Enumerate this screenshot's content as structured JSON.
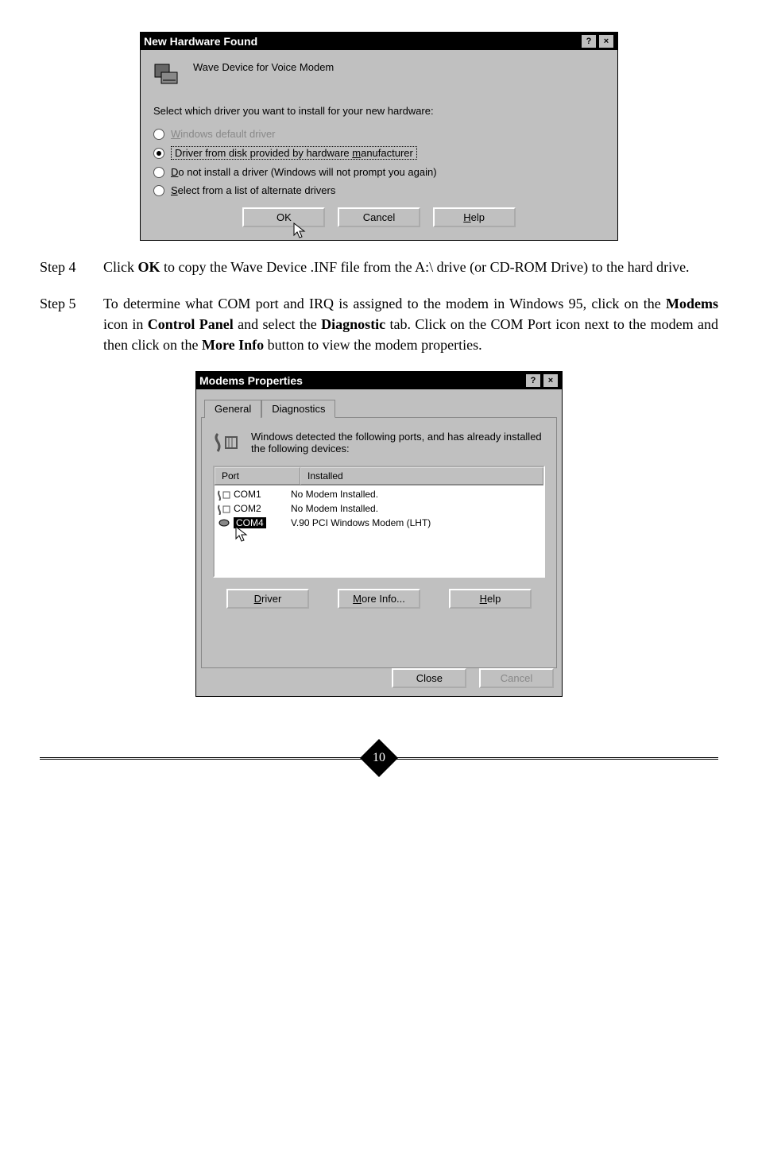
{
  "dialog1": {
    "title": "New Hardware Found",
    "device_label": "Wave Device for Voice Modem",
    "instruction": "Select which driver you want to install for your new hardware:",
    "options": {
      "opt0": "Windows default driver",
      "opt1": "Driver from disk provided by hardware manufacturer",
      "opt2": "Do not install a driver (Windows will not prompt you again)",
      "opt3": "Select from a list of alternate drivers"
    },
    "buttons": {
      "ok": "OK",
      "cancel": "Cancel",
      "help": "Help"
    }
  },
  "steps": {
    "s4_label": "Step 4",
    "s4_body_pre": "Click ",
    "s4_ok": "OK",
    "s4_body_post": " to copy the Wave Device .INF file from the A:\\ drive (or CD-ROM Drive) to the hard drive.",
    "s5_label": "Step 5",
    "s5_a": "To determine what COM port and IRQ is assigned to the modem in Windows 95, click on the ",
    "s5_modems": "Modems",
    "s5_b": " icon in ",
    "s5_cp": "Control Panel",
    "s5_c": " and select the ",
    "s5_diag": "Diagnostic",
    "s5_d": " tab. Click on the COM Port icon next to the modem and then click on the ",
    "s5_more": "More Info",
    "s5_e": " button to view the modem properties."
  },
  "dialog2": {
    "title": "Modems Properties",
    "tab_general": "General",
    "tab_diag": "Diagnostics",
    "info": "Windows detected the following ports, and has already installed the following devices:",
    "col_port": "Port",
    "col_installed": "Installed",
    "rows": {
      "r1_port": "COM1",
      "r1_inst": "No Modem Installed.",
      "r2_port": "COM2",
      "r2_inst": "No Modem Installed.",
      "r3_port": "COM4",
      "r3_inst": "V.90 PCI Windows Modem (LHT)"
    },
    "btn_driver": "Driver",
    "btn_more": "More Info...",
    "btn_help": "Help",
    "btn_close": "Close",
    "btn_cancel": "Cancel"
  },
  "page_number": "10"
}
